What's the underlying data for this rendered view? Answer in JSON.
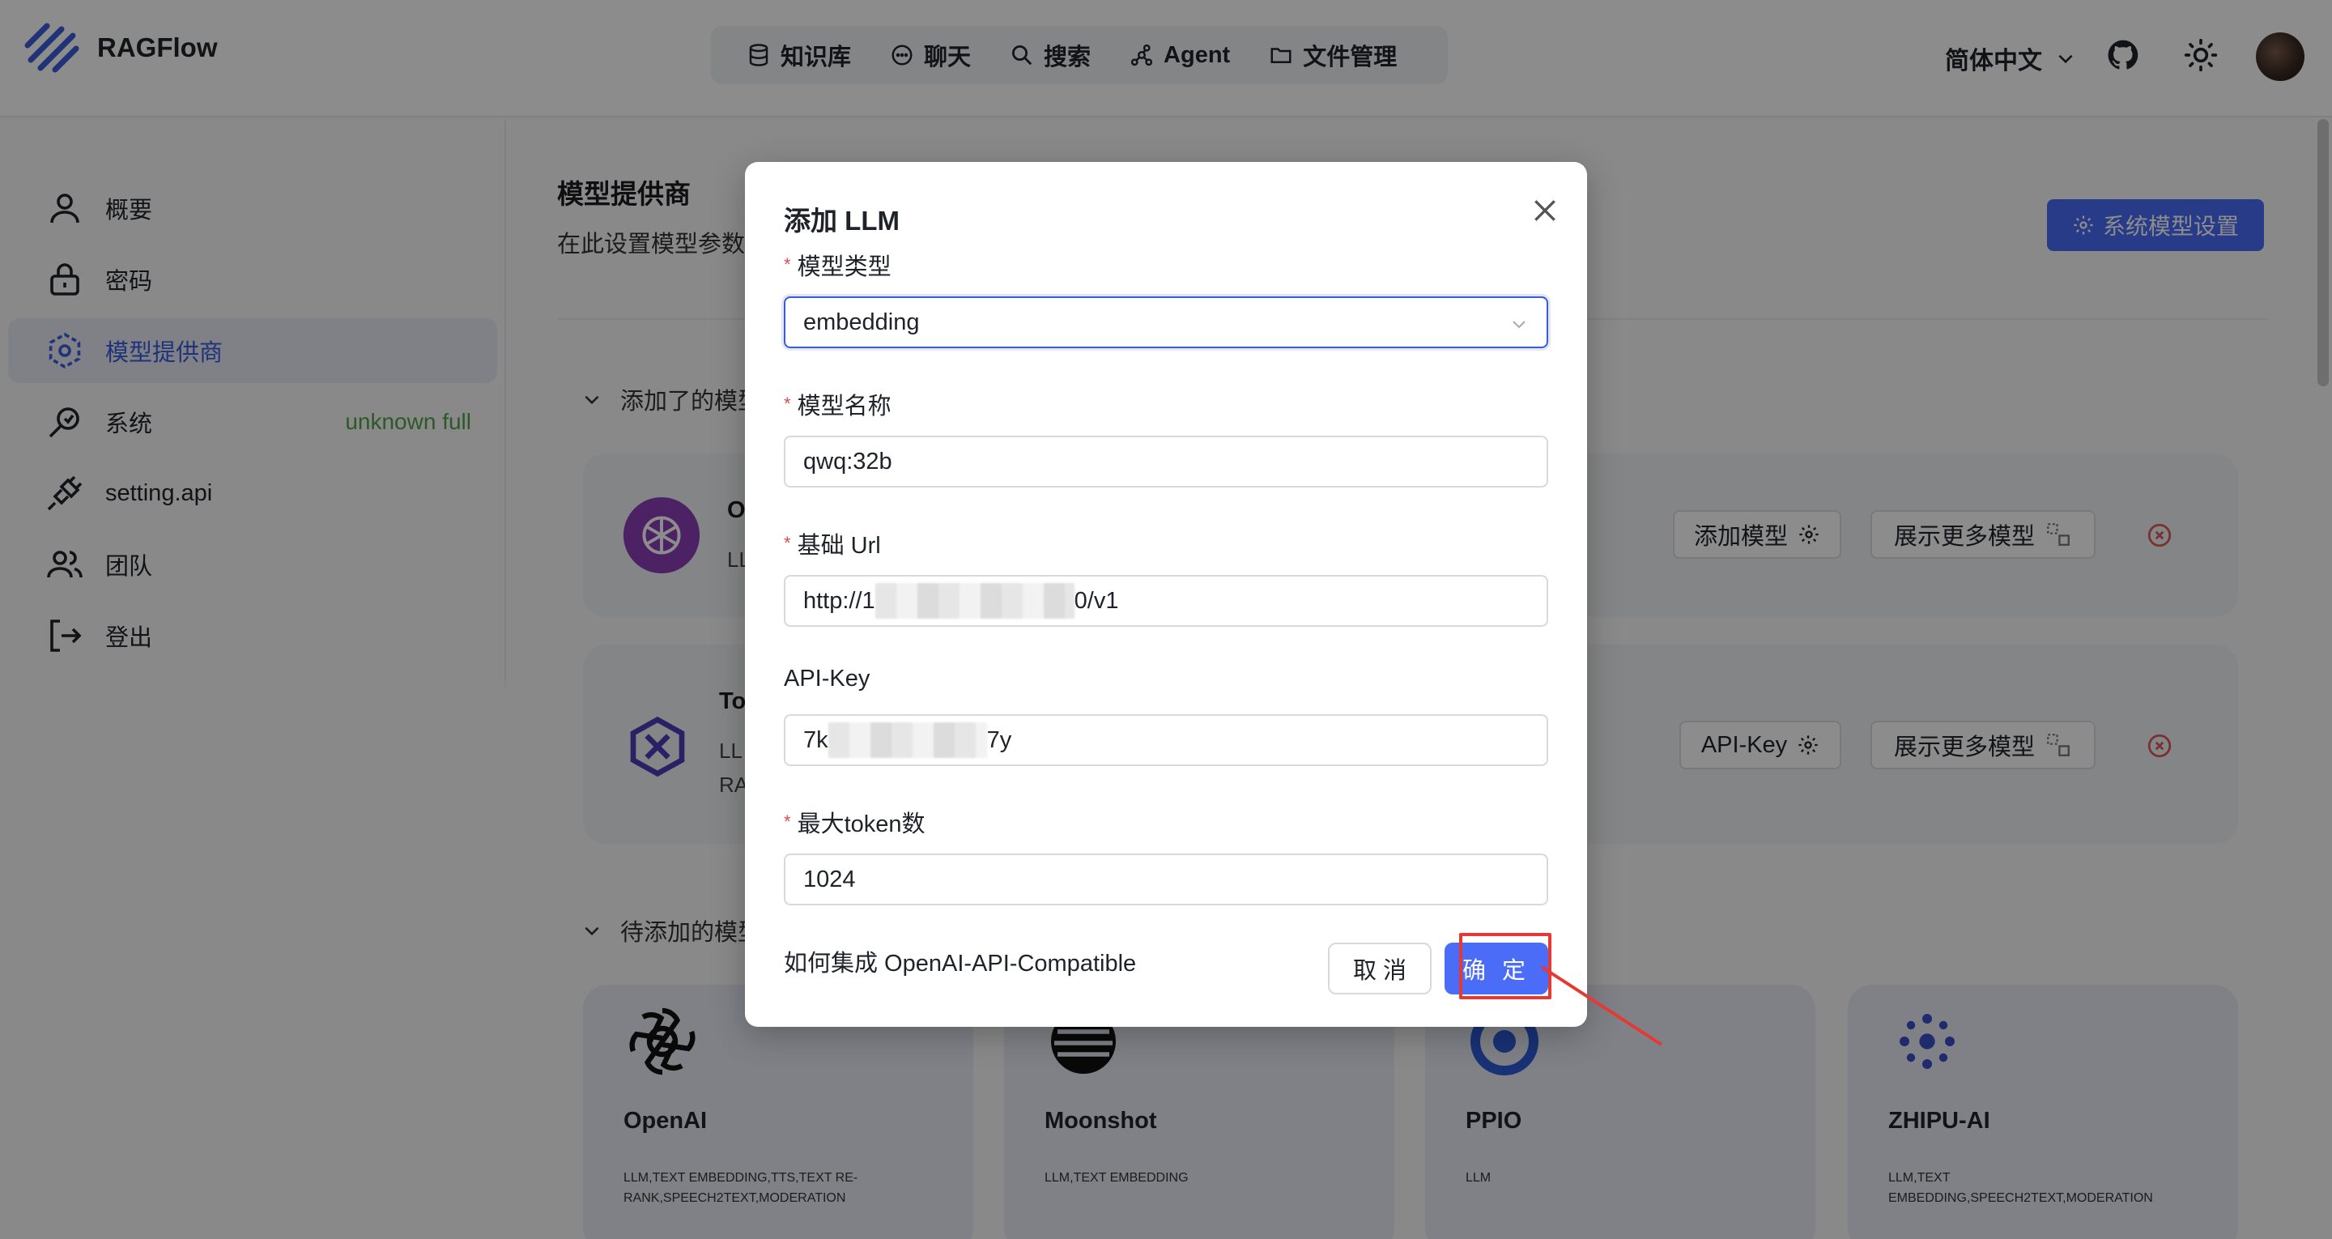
{
  "app": {
    "name": "RAGFlow"
  },
  "nav": [
    {
      "label": "知识库",
      "icon": "database-icon"
    },
    {
      "label": "聊天",
      "icon": "chat-icon"
    },
    {
      "label": "搜索",
      "icon": "search-icon"
    },
    {
      "label": "Agent",
      "icon": "agent-icon"
    },
    {
      "label": "文件管理",
      "icon": "folder-icon"
    }
  ],
  "header": {
    "language": "简体中文"
  },
  "sidebar": {
    "items": [
      {
        "label": "概要",
        "icon": "user-icon"
      },
      {
        "label": "密码",
        "icon": "lock-icon"
      },
      {
        "label": "模型提供商",
        "icon": "model-provider-icon",
        "active": true
      },
      {
        "label": "系统",
        "icon": "system-icon",
        "extra": "unknown full"
      },
      {
        "label": "setting.api",
        "icon": "plug-icon"
      },
      {
        "label": "团队",
        "icon": "team-icon"
      },
      {
        "label": "登出",
        "icon": "logout-icon"
      }
    ]
  },
  "main": {
    "title": "模型提供商",
    "subtitle": "在此设置模型参数和",
    "system_model_button": "系统模型设置",
    "added_section": "添加了的模型",
    "pending_section": "待添加的模型",
    "added_cards": [
      {
        "title_partial": "O",
        "tags_partial": "LL",
        "primary_button": "添加模型",
        "more_button": "展示更多模型"
      },
      {
        "title_partial": "To",
        "tags_partial": "LL",
        "tags_partial_2": "RA",
        "primary_button": "API-Key",
        "more_button": "展示更多模型"
      }
    ],
    "providers": [
      {
        "name": "OpenAI",
        "tags": "LLM,TEXT EMBEDDING,TTS,TEXT RE-RANK,SPEECH2TEXT,MODERATION",
        "icon": "openai-icon"
      },
      {
        "name": "Moonshot",
        "tags": "LLM,TEXT EMBEDDING",
        "icon": "moonshot-icon"
      },
      {
        "name": "PPIO",
        "tags": "LLM",
        "icon": "ppio-icon"
      },
      {
        "name": "ZHIPU-AI",
        "tags": "LLM,TEXT EMBEDDING,SPEECH2TEXT,MODERATION",
        "icon": "zhipu-icon"
      }
    ]
  },
  "modal": {
    "title": "添加 LLM",
    "fields": {
      "model_type": {
        "label": "模型类型",
        "value": "embedding",
        "required": true
      },
      "model_name": {
        "label": "模型名称",
        "value": "qwq:32b",
        "required": true
      },
      "base_url": {
        "label": "基础 Url",
        "value_prefix": "http://1",
        "value_suffix": "0/v1",
        "required": true
      },
      "api_key": {
        "label": "API-Key",
        "value_prefix": "7k",
        "value_suffix": "7y",
        "required": false
      },
      "max_tokens": {
        "label": "最大token数",
        "value": "1024",
        "required": true
      }
    },
    "help_link": "如何集成 OpenAI-API-Compatible",
    "cancel": "取 消",
    "confirm": "确 定"
  },
  "colors": {
    "accent": "#4a6cf7",
    "required": "#e54848",
    "highlight": "#e53935",
    "status_green": "#52a24a"
  }
}
